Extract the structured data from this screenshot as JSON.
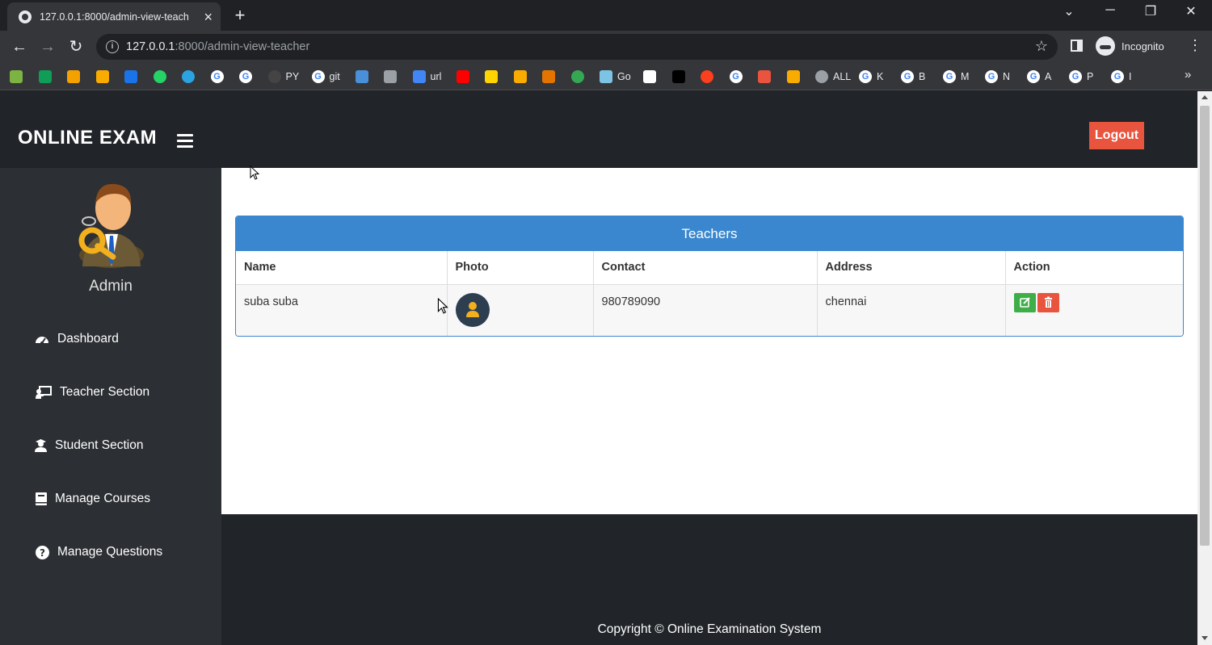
{
  "browser": {
    "tab_title": "127.0.0.1:8000/admin-view-teach",
    "url_host": "127.0.0.1",
    "url_path": ":8000/admin-view-teacher",
    "profile_label": "Incognito",
    "bookmarks": [
      {
        "label": "",
        "icon": "green-leaf-icon",
        "color": "#7cb342"
      },
      {
        "label": "",
        "icon": "green-plus-icon",
        "color": "#0f9d58"
      },
      {
        "label": "",
        "icon": "orange-app-icon",
        "color": "#f4a100"
      },
      {
        "label": "",
        "icon": "bar-chart-icon",
        "color": "#f9ab00"
      },
      {
        "label": "",
        "icon": "ieee-icon",
        "color": "#1a73e8"
      },
      {
        "label": "",
        "icon": "whatsapp-icon",
        "color": "#25d366"
      },
      {
        "label": "",
        "icon": "telegram-icon",
        "color": "#2aa3e0"
      },
      {
        "label": "",
        "icon": "google-icon",
        "color": "#ffffff"
      },
      {
        "label": "",
        "icon": "google-icon",
        "color": "#ffffff"
      },
      {
        "label": "PY",
        "icon": "github-icon",
        "color": "#444444"
      },
      {
        "label": "git",
        "icon": "google-icon",
        "color": "#ffffff"
      },
      {
        "label": "",
        "icon": "blue-doc-icon",
        "color": "#4a90d9"
      },
      {
        "label": "",
        "icon": "store-icon",
        "color": "#9aa0a6"
      },
      {
        "label": "url",
        "icon": "cloud-icon",
        "color": "#4285f4"
      },
      {
        "label": "",
        "icon": "youtube-icon",
        "color": "#ff0000"
      },
      {
        "label": "",
        "icon": "p-icon",
        "color": "#ffd400"
      },
      {
        "label": "",
        "icon": "film-icon",
        "color": "#f9ab00"
      },
      {
        "label": "",
        "icon": "r-icon",
        "color": "#e37400"
      },
      {
        "label": "",
        "icon": "ring-icon",
        "color": "#34a853"
      },
      {
        "label": "Go",
        "icon": "go-icon",
        "color": "#7dc4e4"
      },
      {
        "label": "",
        "icon": "white-doc-icon",
        "color": "#ffffff"
      },
      {
        "label": "",
        "icon": "cl-icon",
        "color": "#000000"
      },
      {
        "label": "",
        "icon": "yandex-icon",
        "color": "#fc3f1d"
      },
      {
        "label": "",
        "icon": "google-icon",
        "color": "#ffffff"
      },
      {
        "label": "",
        "icon": "red-arrow-icon",
        "color": "#e8543e"
      },
      {
        "label": "",
        "icon": "eye-icon",
        "color": "#f9ab00"
      },
      {
        "label": "ALL",
        "icon": "globe-icon",
        "color": "#9aa0a6"
      },
      {
        "label": "K",
        "icon": "google-icon",
        "color": "#ffffff"
      },
      {
        "label": "B",
        "icon": "google-icon",
        "color": "#ffffff"
      },
      {
        "label": "M",
        "icon": "google-icon",
        "color": "#ffffff"
      },
      {
        "label": "N",
        "icon": "google-icon",
        "color": "#ffffff"
      },
      {
        "label": "A",
        "icon": "google-icon",
        "color": "#ffffff"
      },
      {
        "label": "P",
        "icon": "google-icon",
        "color": "#ffffff"
      },
      {
        "label": "I",
        "icon": "google-icon",
        "color": "#ffffff"
      }
    ]
  },
  "header": {
    "brand": "ONLINE EXAM",
    "logout_label": "Logout"
  },
  "sidebar": {
    "user_label": "Admin",
    "items": [
      {
        "label": "Dashboard",
        "icon": "tachometer-icon"
      },
      {
        "label": "Teacher Section",
        "icon": "chalkboard-teacher-icon"
      },
      {
        "label": "Student Section",
        "icon": "user-graduate-icon"
      },
      {
        "label": "Manage Courses",
        "icon": "book-icon"
      },
      {
        "label": "Manage Questions",
        "icon": "question-circle-icon"
      }
    ]
  },
  "teachers_panel": {
    "title": "Teachers",
    "columns": [
      "Name",
      "Photo",
      "Contact",
      "Address",
      "Action"
    ],
    "rows": [
      {
        "name": "suba suba",
        "contact": "980789090",
        "address": "chennai"
      }
    ]
  },
  "footer": {
    "copyright": "Copyright © Online Examination System"
  },
  "colors": {
    "accent_blue": "#3a87cf",
    "logout_red": "#e8543e",
    "edit_green": "#3fae49",
    "dark_bg": "#212529"
  }
}
